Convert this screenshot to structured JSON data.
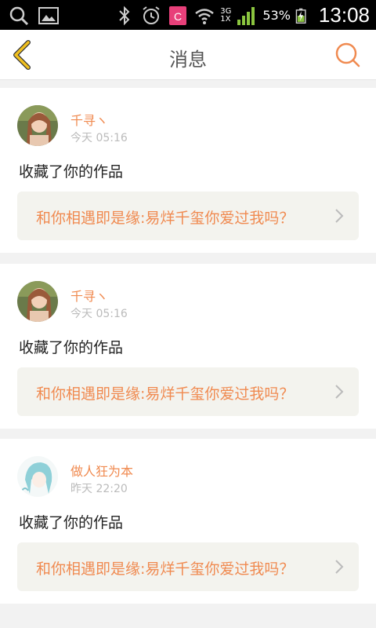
{
  "status_bar": {
    "network": "3G",
    "network_sub": "1X",
    "battery": "53%",
    "time": "13:08"
  },
  "header": {
    "title": "消息"
  },
  "messages": [
    {
      "user": "千寻ヽ",
      "time": "今天 05:16",
      "action": "收藏了你的作品",
      "work_title": "和你相遇即是缘:易烊千玺你爱过我吗？"
    },
    {
      "user": "千寻ヽ",
      "time": "今天 05:16",
      "action": "收藏了你的作品",
      "work_title": "和你相遇即是缘:易烊千玺你爱过我吗？"
    },
    {
      "user": "做人狂为本",
      "time": "昨天 22:20",
      "action": "收藏了你的作品",
      "work_title": "和你相遇即是缘:易烊千玺你爱过我吗？"
    }
  ],
  "colors": {
    "accent": "#f08a50",
    "back_arrow": "#e8b020",
    "card_link_bg": "#f3f3ee"
  }
}
